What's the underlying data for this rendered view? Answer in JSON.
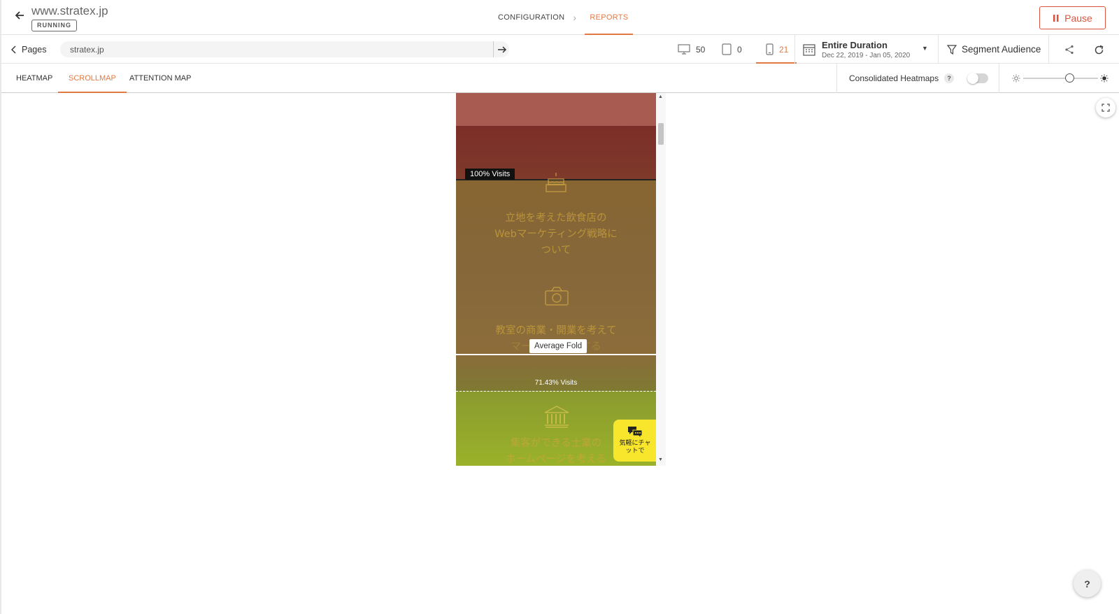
{
  "header": {
    "site_title": "www.stratex.jp",
    "status": "RUNNING",
    "breadcrumbs": [
      {
        "label": "CONFIGURATION"
      },
      {
        "label": "REPORTS"
      }
    ],
    "pause_label": "Pause"
  },
  "subbar": {
    "pages_label": "Pages",
    "url_value": "stratex.jp",
    "devices": [
      {
        "name": "desktop",
        "count": "50"
      },
      {
        "name": "tablet",
        "count": "0"
      },
      {
        "name": "mobile",
        "count": "21"
      }
    ],
    "duration_title": "Entire Duration",
    "duration_range": "Dec 22, 2019 - Jan 05, 2020",
    "segment_label": "Segment Audience"
  },
  "tabs": [
    {
      "label": "HEATMAP"
    },
    {
      "label": "SCROLLMAP"
    },
    {
      "label": "ATTENTION MAP"
    }
  ],
  "options": {
    "consolidated_label": "Consolidated Heatmaps",
    "help": "?",
    "consolidated_enabled": false,
    "brightness_level": 0.62
  },
  "scrollmap": {
    "visits_100": "100% Visits",
    "average_fold": "Average Fold",
    "visits_7143": "71.43% Visits",
    "section_1": [
      "立地を考えた飲食店の",
      "Webマーケティング戦略に",
      "ついて"
    ],
    "section_2": [
      "教室の商業・開業を考えて",
      "マーケティングする"
    ],
    "section_3": [
      "集客ができる士業の",
      "ホームページを考える"
    ],
    "chat_text": [
      "気軽にチャ",
      "ットで"
    ]
  },
  "help_fab": "?",
  "colors": {
    "accent": "#e07a45",
    "pause": "#d9543e"
  }
}
